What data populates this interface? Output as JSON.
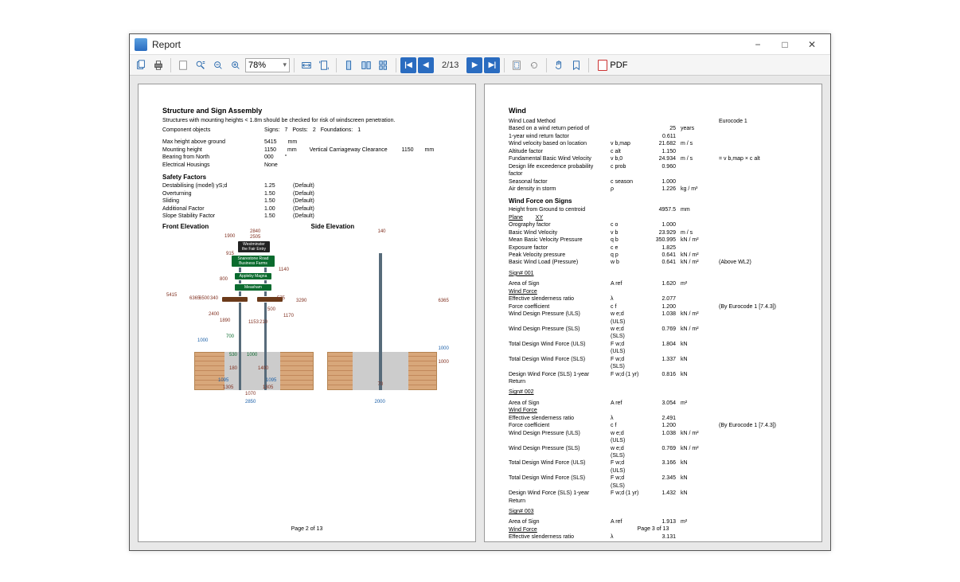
{
  "window": {
    "title": "Report",
    "minimize": "−",
    "maximize": "□",
    "close": "✕"
  },
  "toolbar": {
    "zoom": "78%",
    "page_indicator": "2/13",
    "pdf_label": "PDF"
  },
  "page_left": {
    "heading": "Structure and Sign Assembly",
    "note": "Structures with mounting heights < 1.8m should be checked for risk of windscreen penetration.",
    "components": {
      "label": "Component objects",
      "signs_label": "Signs:",
      "signs": "7",
      "posts_label": "Posts:",
      "posts": "2",
      "foundations_label": "Foundations:",
      "foundations": "1"
    },
    "geom": {
      "max_h_label": "Max height above ground",
      "max_h_val": "5415",
      "max_h_unit": "mm",
      "mount_label": "Mounting height",
      "mount_val": "1150",
      "mount_unit": "mm",
      "clearance_label": "Vertical Carriageway Clearance",
      "clearance_val": "1150",
      "clearance_unit": "mm",
      "bearing_label": "Bearing from North",
      "bearing_val": "000",
      "bearing_unit": "°",
      "elec_label": "Electrical Housings",
      "elec_val": "None"
    },
    "sf": {
      "heading": "Safety Factors",
      "r1": {
        "lab": "Destabilising (model) γS;d",
        "val": "1.25",
        "def": "(Default)"
      },
      "r2": {
        "lab": "Overturning",
        "val": "1.50",
        "def": "(Default)"
      },
      "r3": {
        "lab": "Sliding",
        "val": "1.50",
        "def": "(Default)"
      },
      "r4": {
        "lab": "Additional Factor",
        "val": "1.00",
        "def": "(Default)"
      },
      "r5": {
        "lab": "Slope Stability Factor",
        "val": "1.50",
        "def": "(Default)"
      }
    },
    "front_caption": "Front Elevation",
    "side_caption": "Side Elevation",
    "footer": "Page 2 of 13",
    "signs": {
      "s1": "Westminster the Fair Entry",
      "s2": "Snarestone Road Business Farms",
      "s3": "Appleby Magna",
      "s4": "Measham"
    },
    "dims": {
      "d5415": "5415",
      "d1900": "1900",
      "d2840": "2840",
      "d2505": "2505",
      "d915": "915",
      "d800": "800",
      "d6365l": "6365",
      "d6500": "6500",
      "d2400": "2400",
      "d1890": "1890",
      "d1140": "1140",
      "d340": "340",
      "d575": "575",
      "d500": "500",
      "d1170": "1170",
      "d1153": "1153",
      "d210": "210",
      "d3290": "3290",
      "d6365r": "6365",
      "d700": "700",
      "d530": "530",
      "d1000a": "1000",
      "d180": "180",
      "d1400": "1400",
      "d1095a": "1095",
      "d1095b": "1095",
      "d1305a": "1305",
      "d1305b": "1305",
      "d1070": "1070",
      "d2850": "2850",
      "dside140": "140",
      "dside1000a": "1000",
      "dside1000b": "1000",
      "dside70": "70",
      "dside2000": "2000"
    }
  },
  "page_right": {
    "heading": "Wind",
    "method_label": "Wind Load Method",
    "method_val": "Eurocode 1",
    "return_label": "Based on a wind return period of",
    "return_val": "25",
    "return_unit": "years",
    "rows": [
      {
        "lab": "1-year wind return factor",
        "sym": "",
        "val": "0.611",
        "unit": ""
      },
      {
        "lab": "Wind velocity based on location",
        "sym": "v b,map",
        "val": "21.682",
        "unit": "m / s"
      },
      {
        "lab": "Altitude factor",
        "sym": "c alt",
        "val": "1.150",
        "unit": ""
      },
      {
        "lab": "Fundamental Basic Wind Velocity",
        "sym": "v b,0",
        "val": "24.934",
        "unit": "m / s",
        "note": "= v b,map × c alt"
      },
      {
        "lab": "Design life exceedence probability factor",
        "sym": "c prob",
        "val": "0.960",
        "unit": ""
      },
      {
        "lab": "Seasonal factor",
        "sym": "c season",
        "val": "1.000",
        "unit": ""
      },
      {
        "lab": "Air density in storm",
        "sym": "ρ",
        "val": "1.226",
        "unit": "kg / m³"
      }
    ],
    "wfs_heading": "Wind Force on Signs",
    "height_row": {
      "lab": "Height from Ground to centroid",
      "val": "4957.5",
      "unit": "mm"
    },
    "plane_label": "Plane",
    "plane_val": "XY",
    "plane_rows": [
      {
        "lab": "Orography factor",
        "sym": "c o",
        "val": "1.000",
        "unit": ""
      },
      {
        "lab": "Basic Wind Velocity",
        "sym": "v b",
        "val": "23.929",
        "unit": "m / s"
      },
      {
        "lab": "Mean Basic Velocity Pressure",
        "sym": "q b",
        "val": "350.995",
        "unit": "kN / m²"
      },
      {
        "lab": "Exposure factor",
        "sym": "c e",
        "val": "1.825",
        "unit": ""
      },
      {
        "lab": "Peak Velocity pressure",
        "sym": "q p",
        "val": "0.641",
        "unit": "kN / m²"
      },
      {
        "lab": "Basic Wind Load (Pressure)",
        "sym": "w b",
        "val": "0.641",
        "unit": "kN / m²",
        "note": "(Above WL2)"
      }
    ],
    "s001": {
      "heading": "Sign#   001",
      "area": {
        "lab": "Area of Sign",
        "sym": "A ref",
        "val": "1.620",
        "unit": "m²"
      },
      "wf": "Wind Force",
      "rows": [
        {
          "lab": "Effective slenderness ratio",
          "sym": "λ",
          "val": "2.077",
          "unit": ""
        },
        {
          "lab": "Force coefficient",
          "sym": "c f",
          "val": "1.200",
          "unit": "",
          "note": "(By Eurocode 1 [7.4.3])"
        },
        {
          "lab": "Wind Design Pressure (ULS)",
          "sym": "w e;d (ULS)",
          "val": "1.038",
          "unit": "kN / m²"
        },
        {
          "lab": "Wind Design Pressure (SLS)",
          "sym": "w e;d (SLS)",
          "val": "0.769",
          "unit": "kN / m²"
        },
        {
          "lab": "Total Design Wind Force (ULS)",
          "sym": "F w;d (ULS)",
          "val": "1.804",
          "unit": "kN"
        },
        {
          "lab": "Total Design Wind Force (SLS)",
          "sym": "F w;d (SLS)",
          "val": "1.337",
          "unit": "kN"
        },
        {
          "lab": "Design Wind Force (SLS) 1-year Return",
          "sym": "F w;d (1 yr)",
          "val": "0.816",
          "unit": "kN"
        }
      ]
    },
    "s002": {
      "heading": "Sign#   002",
      "area": {
        "lab": "Area of Sign",
        "sym": "A ref",
        "val": "3.054",
        "unit": "m²"
      },
      "wf": "Wind Force",
      "rows": [
        {
          "lab": "Effective slenderness ratio",
          "sym": "λ",
          "val": "2.491",
          "unit": ""
        },
        {
          "lab": "Force coefficient",
          "sym": "c f",
          "val": "1.200",
          "unit": "",
          "note": "(By Eurocode 1 [7.4.3])"
        },
        {
          "lab": "Wind Design Pressure (ULS)",
          "sym": "w e;d (ULS)",
          "val": "1.038",
          "unit": "kN / m²"
        },
        {
          "lab": "Wind Design Pressure (SLS)",
          "sym": "w e;d (SLS)",
          "val": "0.769",
          "unit": "kN / m²"
        },
        {
          "lab": "Total Design Wind Force (ULS)",
          "sym": "F w;d (ULS)",
          "val": "3.166",
          "unit": "kN"
        },
        {
          "lab": "Total Design Wind Force (SLS)",
          "sym": "F w;d (SLS)",
          "val": "2.345",
          "unit": "kN"
        },
        {
          "lab": "Design Wind Force (SLS) 1-year Return",
          "sym": "F w;d (1 yr)",
          "val": "1.432",
          "unit": "kN"
        }
      ]
    },
    "s003": {
      "heading": "Sign#   003",
      "area": {
        "lab": "Area of Sign",
        "sym": "A ref",
        "val": "1.913",
        "unit": "m²"
      },
      "wf": "Wind Force",
      "rows": [
        {
          "lab": "Effective slenderness ratio",
          "sym": "λ",
          "val": "3.131",
          "unit": ""
        }
      ]
    },
    "footer": "Page 3 of 13"
  }
}
